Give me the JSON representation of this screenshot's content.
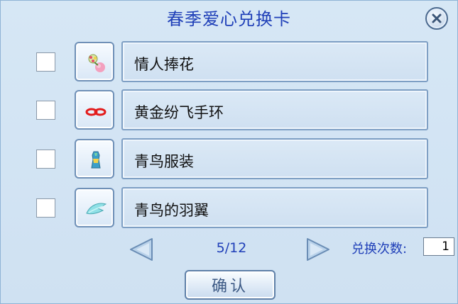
{
  "window": {
    "title": "春季爱心兑换卡"
  },
  "items": [
    {
      "name": "情人捧花",
      "icon": "flower-bouquet-icon",
      "checked": false
    },
    {
      "name": "黄金纷飞手环",
      "icon": "red-bracelet-icon",
      "checked": false
    },
    {
      "name": "青鸟服装",
      "icon": "bird-costume-icon",
      "checked": false
    },
    {
      "name": "青鸟的羽翼",
      "icon": "feather-wing-icon",
      "checked": false
    }
  ],
  "pagination": {
    "page_text": "5/12"
  },
  "exchange": {
    "label": "兑换次数:",
    "value": "1"
  },
  "confirm_label": "确认",
  "colors": {
    "title": "#1f3fb8",
    "panel_bg": "#d6e7f5",
    "border": "#7e9fc4"
  }
}
